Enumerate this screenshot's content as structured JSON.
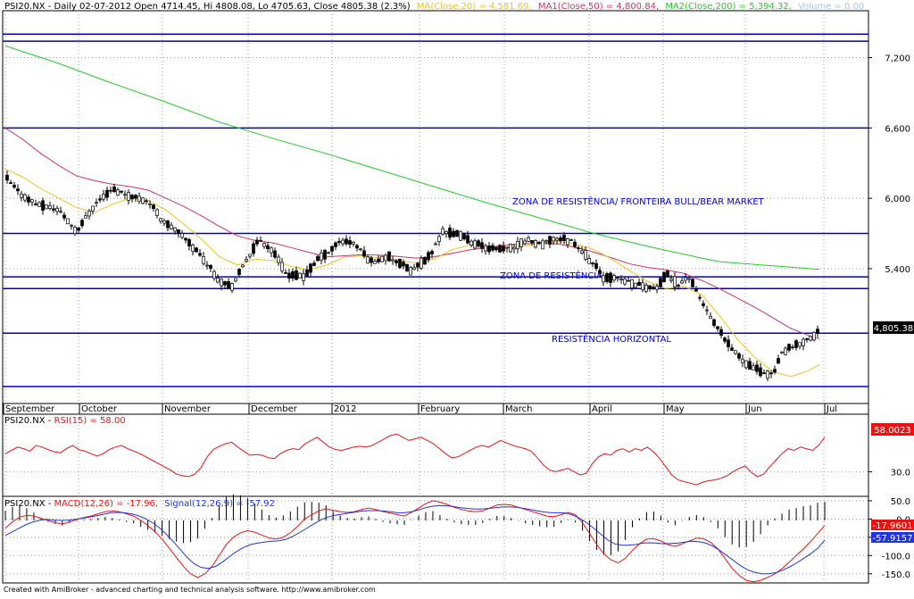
{
  "footer": "Created with AmiBroker - advanced charting and technical analysis software. http://www.amibroker.com",
  "price_header": {
    "symbol": "PSI20.NX - Daily 02-07-2012 Open 4714.45, Hi 4808.08, Lo 4705.63, Close 4805.38 (2.3%)",
    "ma20": "MA(Close,20) = 4,581.69,",
    "ma50": "MA1(Close,50) = 4,800.84,",
    "ma200": "MA2(Close,200) = 5,394.32,",
    "volume": "Volume = 0.00"
  },
  "rsi_header": {
    "symbol": "PSI20.NX - ",
    "rsi": "RSI(15) = 58.00"
  },
  "macd_header": {
    "symbol": "PSI20.NX - ",
    "macd": "MACD(12,26) = -17.96,",
    "signal": "Signal(12,26,9) = -57.92"
  },
  "colors": {
    "up_candle": "#ffffff",
    "down_candle": "#000000",
    "hline": "#0000cc",
    "ma20": "#f0c020",
    "ma50": "#cc3366",
    "ma200": "#22cc22",
    "rsi": "#ee1111",
    "macd": "#ee1111",
    "signal": "#2233dd",
    "label_price": "#000000",
    "label_rsi": "#ee1111",
    "label_signal": "#2233dd"
  },
  "chart_data": [
    {
      "type": "candlestick",
      "title": "PSI20.NX - Daily 02-07-2012",
      "ylim": [
        4250,
        7600
      ],
      "yticks": [
        "7,200",
        "6,600",
        "6,000",
        "5,400"
      ],
      "x_labels": [
        "September",
        "October",
        "November",
        "December",
        "2012",
        "February",
        "March",
        "April",
        "May",
        "Jun",
        "Jul"
      ],
      "last_value_label": "4,805.38",
      "horizontal_lines": [
        7400,
        7340,
        6600,
        5700,
        5330,
        5230,
        4850,
        4395
      ],
      "annotations": [
        "ZONA DE RESISTÊNCIA/ FRONTEIRA BULL/BEAR MARKET",
        "ZONA DE RESISTÊNCIA",
        "RESISTÊNCIA HORIZONTAL"
      ],
      "series": [
        {
          "name": "MA2(Close,200)",
          "points": [
            [
              0,
              7300
            ],
            [
              60,
              7150
            ],
            [
              120,
              6980
            ],
            [
              180,
              6820
            ],
            [
              240,
              6650
            ],
            [
              300,
              6510
            ],
            [
              360,
              6380
            ],
            [
              420,
              6240
            ],
            [
              480,
              6100
            ],
            [
              540,
              5960
            ],
            [
              600,
              5830
            ],
            [
              660,
              5700
            ],
            [
              720,
              5590
            ],
            [
              780,
              5490
            ],
            [
              800,
              5460
            ],
            [
              850,
              5430
            ],
            [
              912,
              5394
            ]
          ]
        },
        {
          "name": "MA1(Close,50)",
          "points": [
            [
              0,
              6600
            ],
            [
              20,
              6500
            ],
            [
              40,
              6380
            ],
            [
              60,
              6280
            ],
            [
              80,
              6190
            ],
            [
              100,
              6150
            ],
            [
              120,
              6120
            ],
            [
              140,
              6100
            ],
            [
              160,
              6070
            ],
            [
              180,
              6000
            ],
            [
              200,
              5930
            ],
            [
              220,
              5850
            ],
            [
              240,
              5760
            ],
            [
              260,
              5680
            ],
            [
              280,
              5640
            ],
            [
              300,
              5620
            ],
            [
              320,
              5580
            ],
            [
              340,
              5540
            ],
            [
              360,
              5500
            ],
            [
              380,
              5510
            ],
            [
              400,
              5520
            ],
            [
              420,
              5515
            ],
            [
              440,
              5505
            ],
            [
              460,
              5490
            ],
            [
              480,
              5500
            ],
            [
              500,
              5530
            ],
            [
              520,
              5560
            ],
            [
              540,
              5580
            ],
            [
              560,
              5600
            ],
            [
              580,
              5610
            ],
            [
              600,
              5620
            ],
            [
              620,
              5610
            ],
            [
              640,
              5580
            ],
            [
              660,
              5540
            ],
            [
              680,
              5490
            ],
            [
              700,
              5440
            ],
            [
              720,
              5410
            ],
            [
              740,
              5390
            ],
            [
              760,
              5360
            ],
            [
              780,
              5300
            ],
            [
              800,
              5230
            ],
            [
              820,
              5150
            ],
            [
              840,
              5070
            ],
            [
              860,
              4980
            ],
            [
              880,
              4890
            ],
            [
              900,
              4830
            ],
            [
              912,
              4801
            ]
          ]
        },
        {
          "name": "MA(Close,20)",
          "points": [
            [
              0,
              6250
            ],
            [
              20,
              6180
            ],
            [
              40,
              6080
            ],
            [
              60,
              6000
            ],
            [
              80,
              5920
            ],
            [
              100,
              5880
            ],
            [
              120,
              5950
            ],
            [
              140,
              6000
            ],
            [
              160,
              5980
            ],
            [
              180,
              5900
            ],
            [
              200,
              5780
            ],
            [
              220,
              5650
            ],
            [
              240,
              5500
            ],
            [
              260,
              5430
            ],
            [
              280,
              5480
            ],
            [
              300,
              5470
            ],
            [
              320,
              5420
            ],
            [
              340,
              5390
            ],
            [
              360,
              5430
            ],
            [
              380,
              5500
            ],
            [
              400,
              5510
            ],
            [
              420,
              5490
            ],
            [
              440,
              5470
            ],
            [
              460,
              5450
            ],
            [
              480,
              5480
            ],
            [
              500,
              5560
            ],
            [
              520,
              5600
            ],
            [
              540,
              5580
            ],
            [
              560,
              5570
            ],
            [
              580,
              5590
            ],
            [
              600,
              5620
            ],
            [
              620,
              5630
            ],
            [
              640,
              5610
            ],
            [
              660,
              5560
            ],
            [
              680,
              5480
            ],
            [
              700,
              5380
            ],
            [
              720,
              5290
            ],
            [
              740,
              5230
            ],
            [
              760,
              5250
            ],
            [
              780,
              5180
            ],
            [
              800,
              5000
            ],
            [
              820,
              4800
            ],
            [
              840,
              4640
            ],
            [
              860,
              4520
            ],
            [
              880,
              4480
            ],
            [
              900,
              4530
            ],
            [
              912,
              4582
            ]
          ]
        }
      ]
    },
    {
      "type": "line",
      "title": "RSI(15)",
      "ylim": [
        0,
        100
      ],
      "yticks": [
        "30.0"
      ],
      "last_value_label": "58.0023",
      "series": [
        {
          "name": "RSI(15)",
          "values": [
            52,
            56,
            60,
            58,
            55,
            62,
            60,
            57,
            54,
            53,
            58,
            62,
            57,
            55,
            52,
            49,
            52,
            57,
            60,
            62,
            58,
            55,
            52,
            48,
            44,
            40,
            36,
            32,
            27,
            25,
            24,
            27,
            35,
            48,
            57,
            61,
            64,
            66,
            60,
            55,
            50,
            51,
            50,
            47,
            46,
            52,
            56,
            58,
            57,
            64,
            68,
            72,
            66,
            60,
            57,
            56,
            58,
            60,
            61,
            60,
            62,
            66,
            70,
            74,
            76,
            72,
            68,
            70,
            72,
            68,
            64,
            58,
            52,
            47,
            48,
            52,
            56,
            60,
            62,
            60,
            64,
            68,
            65,
            62,
            60,
            58,
            55,
            47,
            38,
            32,
            30,
            32,
            34,
            30,
            26,
            28,
            40,
            48,
            52,
            50,
            56,
            58,
            54,
            58,
            56,
            60,
            54,
            46,
            36,
            26,
            20,
            18,
            16,
            14,
            17,
            19,
            20,
            22,
            25,
            30,
            34,
            37,
            29,
            24,
            27,
            36,
            44,
            52,
            58,
            56,
            60,
            58,
            56,
            62,
            72
          ]
        }
      ]
    },
    {
      "type": "line",
      "title": "MACD(12,26)",
      "ylim": [
        -175,
        62
      ],
      "yticks": [
        "50.0",
        "0.0",
        "-50.0",
        "-100.0",
        "-150.0"
      ],
      "macd_label": "-17.9601",
      "signal_label": "-57.9157",
      "series": [
        {
          "name": "MACD(12,26)",
          "values": [
            -25,
            -8,
            5,
            10,
            8,
            2,
            -4,
            -10,
            -14,
            -8,
            -2,
            4,
            8,
            14,
            20,
            22,
            20,
            14,
            8,
            -4,
            -18,
            -35,
            -55,
            -80,
            -105,
            -130,
            -150,
            -160,
            -150,
            -130,
            -100,
            -70,
            -50,
            -38,
            -32,
            -36,
            -44,
            -52,
            -55,
            -50,
            -38,
            -20,
            0,
            12,
            22,
            28,
            24,
            20,
            18,
            20,
            26,
            30,
            26,
            20,
            16,
            12,
            8,
            18,
            30,
            42,
            50,
            46,
            40,
            32,
            26,
            22,
            20,
            22,
            30,
            38,
            40,
            38,
            32,
            26,
            20,
            14,
            8,
            6,
            12,
            18,
            12,
            -10,
            -40,
            -70,
            -95,
            -112,
            -120,
            -108,
            -86,
            -68,
            -55,
            -54,
            -60,
            -70,
            -75,
            -68,
            -60,
            -52,
            -54,
            -64,
            -82,
            -108,
            -135,
            -155,
            -168,
            -172,
            -168,
            -160,
            -150,
            -136,
            -118,
            -100,
            -82,
            -62,
            -40,
            -18
          ]
        },
        {
          "name": "Signal(12,26,9)",
          "values": [
            -45,
            -35,
            -25,
            -15,
            -8,
            -3,
            -1,
            -3,
            -4,
            -3,
            -1,
            2,
            5,
            9,
            13,
            17,
            18,
            17,
            14,
            9,
            1,
            -10,
            -24,
            -42,
            -62,
            -84,
            -106,
            -123,
            -133,
            -135,
            -130,
            -118,
            -103,
            -89,
            -78,
            -70,
            -66,
            -63,
            -61,
            -60,
            -56,
            -48,
            -37,
            -26,
            -14,
            -3,
            5,
            10,
            13,
            16,
            19,
            22,
            23,
            23,
            22,
            20,
            17,
            17,
            20,
            25,
            31,
            35,
            37,
            36,
            34,
            31,
            29,
            27,
            27,
            29,
            31,
            33,
            33,
            32,
            29,
            26,
            22,
            19,
            17,
            17,
            16,
            11,
            2,
            -10,
            -25,
            -41,
            -57,
            -68,
            -72,
            -72,
            -70,
            -66,
            -65,
            -66,
            -68,
            -67,
            -66,
            -63,
            -61,
            -62,
            -66,
            -74,
            -86,
            -100,
            -114,
            -128,
            -139,
            -146,
            -150,
            -150,
            -147,
            -140,
            -131,
            -120,
            -108,
            -95,
            -80,
            -58
          ]
        },
        {
          "name": "Histogram",
          "values": [
            20,
            27,
            30,
            25,
            16,
            5,
            -3,
            -7,
            -10,
            -5,
            -1,
            2,
            3,
            5,
            7,
            5,
            2,
            -3,
            -6,
            -13,
            -19,
            -25,
            -31,
            -38,
            -43,
            -46,
            -44,
            -37,
            -17,
            5,
            30,
            48,
            53,
            51,
            46,
            34,
            22,
            11,
            6,
            10,
            18,
            28,
            37,
            38,
            36,
            31,
            19,
            10,
            5,
            4,
            7,
            8,
            3,
            -3,
            -6,
            -8,
            -9,
            1,
            10,
            17,
            19,
            11,
            3,
            -4,
            -8,
            -9,
            -9,
            -5,
            3,
            9,
            9,
            5,
            -1,
            -6,
            -9,
            -12,
            -14,
            -13,
            -5,
            1,
            -4,
            -21,
            -42,
            -60,
            -70,
            -71,
            -63,
            -40,
            -14,
            4,
            17,
            18,
            10,
            -4,
            -10,
            -1,
            7,
            11,
            7,
            -3,
            -16,
            -34,
            -49,
            -55,
            -54,
            -44,
            -28,
            -10,
            4,
            14,
            22,
            25,
            29,
            31,
            36,
            38
          ]
        }
      ]
    }
  ]
}
